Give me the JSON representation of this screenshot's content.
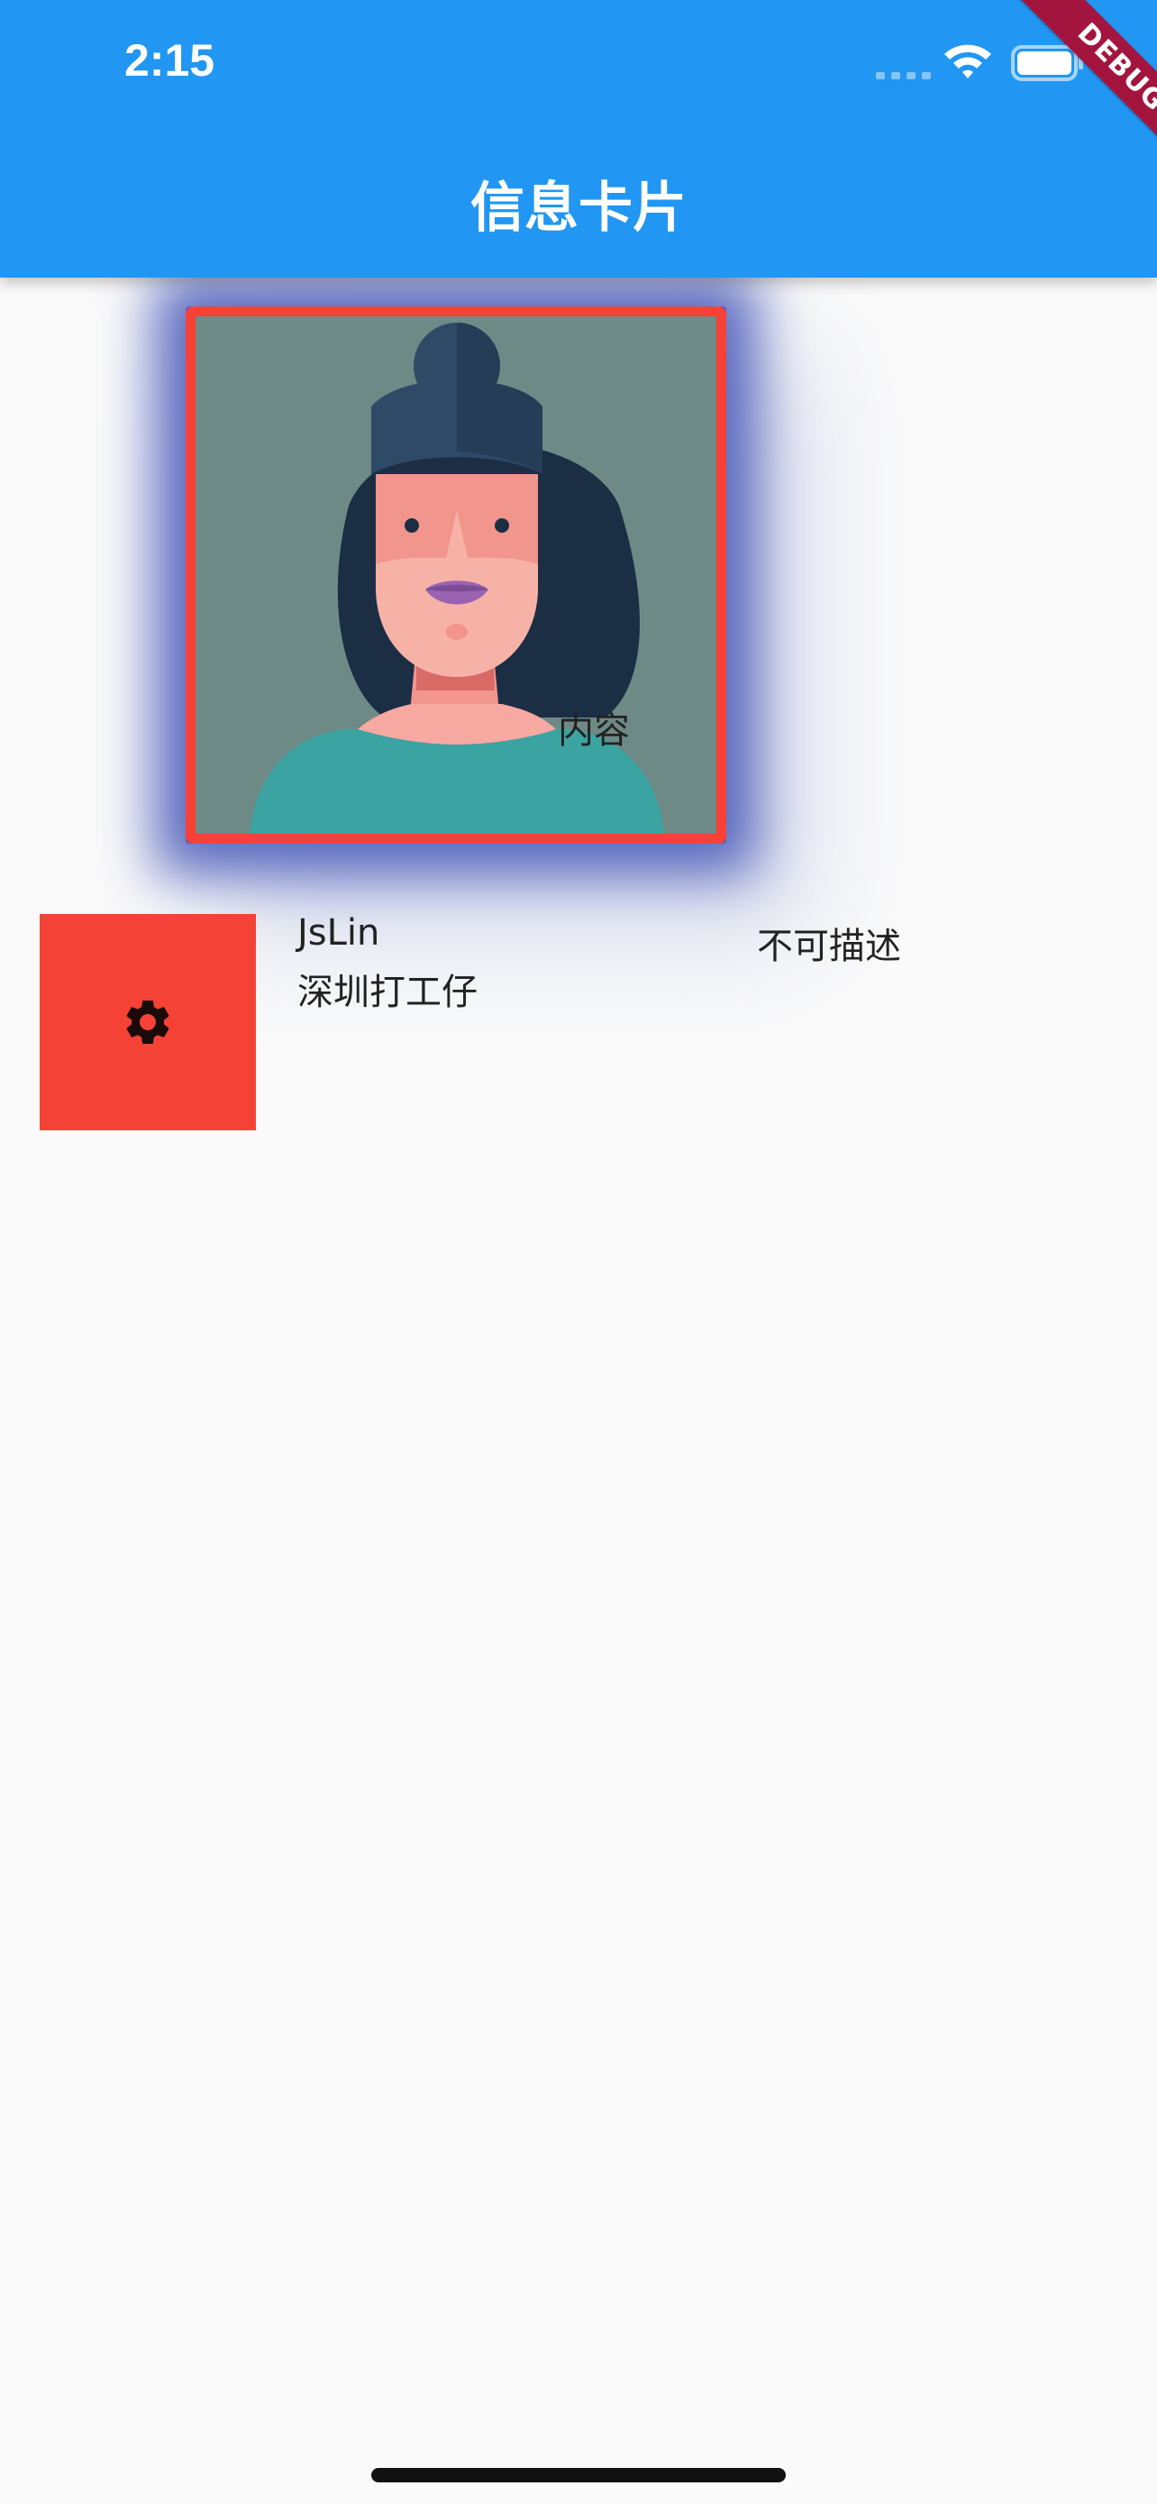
{
  "status_bar": {
    "time": "2:15",
    "icons": [
      "signal-icon",
      "wifi-icon",
      "battery-icon"
    ]
  },
  "app_bar": {
    "title": "信息卡片",
    "background_color": "#2196f3"
  },
  "debug_banner": {
    "label": "DEBUG",
    "color": "#a3153f"
  },
  "avatar_card": {
    "image": "woman-avatar-illustration",
    "border_color": "#f44336",
    "glow_color": "#3f51b5",
    "overlay_text": "内容"
  },
  "info_row": {
    "icon": "settings-icon",
    "tile_color": "#f44336",
    "name": "JsLin",
    "subtitle": "深圳打工仔",
    "side_text": "不可描述"
  }
}
